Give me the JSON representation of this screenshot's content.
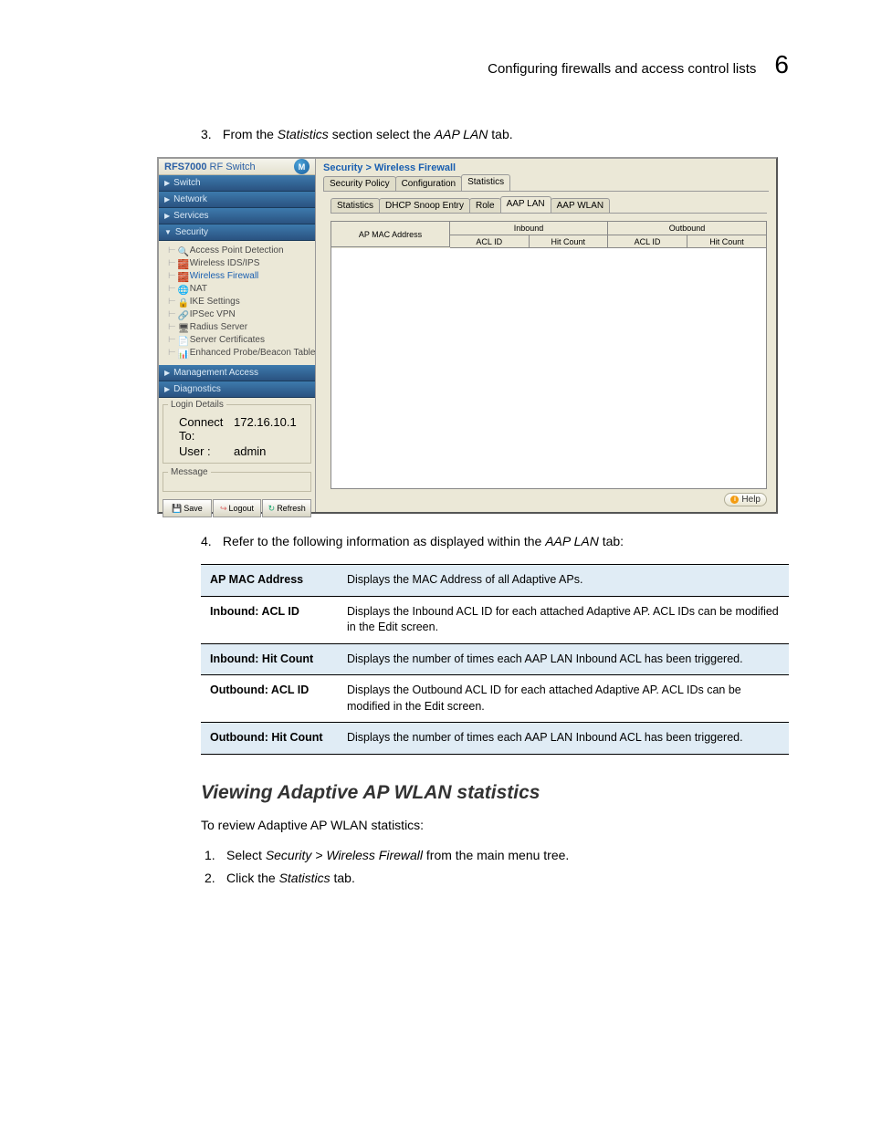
{
  "header": {
    "title": "Configuring firewalls and access control lists",
    "chapter": "6"
  },
  "step3_n": "3.",
  "step3_pre": "From the ",
  "step3_em1": "Statistics",
  "step3_mid": " section select the ",
  "step3_em2": "AAP LAN",
  "step3_post": " tab.",
  "step4_n": "4.",
  "step4_pre": "Refer to the following information as displayed within the ",
  "step4_em": "AAP LAN",
  "step4_post": " tab:",
  "ss": {
    "brand_bold": "RFS7000",
    "brand_rest": " RF Switch",
    "nav": {
      "switch": "Switch",
      "network": "Network",
      "services": "Services",
      "security": "Security",
      "management": "Management Access",
      "diagnostics": "Diagnostics"
    },
    "tree": {
      "apd": "Access Point Detection",
      "ids": "Wireless IDS/IPS",
      "fw": "Wireless Firewall",
      "nat": "NAT",
      "ike": "IKE Settings",
      "ipsec": "IPSec VPN",
      "radius": "Radius Server",
      "cert": "Server Certificates",
      "probe": "Enhanced Probe/Beacon Table"
    },
    "login_legend": "Login Details",
    "connect_k": "Connect To:",
    "connect_v": "172.16.10.1",
    "user_k": "User :",
    "user_v": "admin",
    "msg_legend": "Message",
    "btn_save": "Save",
    "btn_logout": "Logout",
    "btn_refresh": "Refresh",
    "crumb": "Security > Wireless Firewall",
    "tabs_outer": {
      "policy": "Security Policy",
      "config": "Configuration",
      "stats": "Statistics"
    },
    "tabs_inner": {
      "stats": "Statistics",
      "dhcp": "DHCP Snoop Entry",
      "role": "Role",
      "lan": "AAP LAN",
      "wlan": "AAP WLAN"
    },
    "th": {
      "ap": "AP MAC Address",
      "inbound": "Inbound",
      "outbound": "Outbound",
      "acl": "ACL ID",
      "hit": "Hit Count"
    },
    "help": "Help"
  },
  "table": {
    "r1k": "AP MAC Address",
    "r1v": "Displays the MAC Address of all Adaptive APs.",
    "r2k": "Inbound: ACL ID",
    "r2v": "Displays the Inbound ACL ID for each attached Adaptive AP. ACL IDs can be modified in the Edit screen.",
    "r3k": "Inbound: Hit Count",
    "r3v": "Displays the number of times each AAP LAN Inbound ACL has been triggered.",
    "r4k": "Outbound: ACL ID",
    "r4v": "Displays the Outbound ACL ID for each attached Adaptive AP. ACL IDs can be modified in the Edit screen.",
    "r5k": "Outbound: Hit Count",
    "r5v": "Displays the number of times each AAP LAN Inbound ACL has been triggered."
  },
  "h2": "Viewing Adaptive AP WLAN statistics",
  "para": "To review Adaptive AP WLAN statistics:",
  "li1_n": "1.",
  "li1_a": "Select ",
  "li1_em": "Security > Wireless Firewall",
  "li1_b": " from the main menu tree.",
  "li2_n": "2.",
  "li2_a": "Click the ",
  "li2_em": "Statistics",
  "li2_b": " tab."
}
